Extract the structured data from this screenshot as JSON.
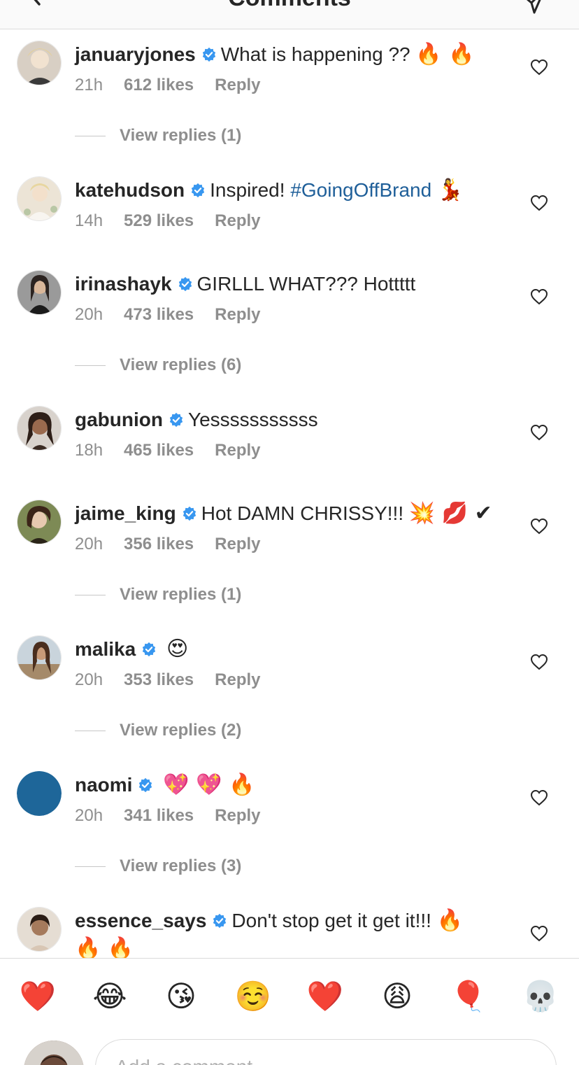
{
  "header": {
    "title": "Comments",
    "back_icon": "chevron-left-icon",
    "share_icon": "direct-share-icon"
  },
  "comments": [
    {
      "username": "januaryjones",
      "text": "What is happening ??",
      "emoji": "🔥 🔥",
      "time": "21h",
      "likes": "612 likes",
      "reply": "Reply",
      "view_replies": "View replies (1)",
      "avatar_color": "#c9b9a6"
    },
    {
      "username": "katehudson",
      "text": "Inspired!",
      "hashtag": "#GoingOffBrand",
      "emoji": "💃",
      "time": "14h",
      "likes": "529 likes",
      "reply": "Reply",
      "avatar_color": "#e8dcc8"
    },
    {
      "username": "irinashayk",
      "text": "GIRLLL WHAT??? Hottttt",
      "time": "20h",
      "likes": "473 likes",
      "reply": "Reply",
      "view_replies": "View replies (6)",
      "avatar_color": "#6e6e6e"
    },
    {
      "username": "gabunion",
      "text": "Yesssssssssss",
      "time": "18h",
      "likes": "465 likes",
      "reply": "Reply",
      "avatar_color": "#5a4337"
    },
    {
      "username": "jaime_king",
      "text": "Hot DAMN CHRISSY!!!",
      "emoji": "💥 💋 ✔",
      "time": "20h",
      "likes": "356 likes",
      "reply": "Reply",
      "view_replies": "View replies (1)",
      "avatar_color": "#6f7a4e"
    },
    {
      "username": "malika",
      "text": "",
      "emoji": "😍",
      "time": "20h",
      "likes": "353 likes",
      "reply": "Reply",
      "view_replies": "View replies (2)",
      "avatar_color": "#8a6a55"
    },
    {
      "username": "naomi",
      "text": "",
      "emoji": "💖 💖 🔥",
      "time": "20h",
      "likes": "341 likes",
      "reply": "Reply",
      "view_replies": "View replies (3)",
      "avatar_color": "#1e6699"
    },
    {
      "username": "essence_says",
      "text": "Don't stop get it get it!!!",
      "emoji": "🔥",
      "emoji_line2": "🔥 🔥",
      "avatar_color": "#b7a595"
    }
  ],
  "emoji_bar": [
    "❤️",
    "😂",
    "😘",
    "☺️",
    "❤️",
    "😩",
    "🎈",
    "💀"
  ],
  "composer": {
    "placeholder": "Add a comment..."
  },
  "colors": {
    "verified": "#3897f0",
    "hashtag": "#1f5f99",
    "meta": "#8e8e8e"
  }
}
